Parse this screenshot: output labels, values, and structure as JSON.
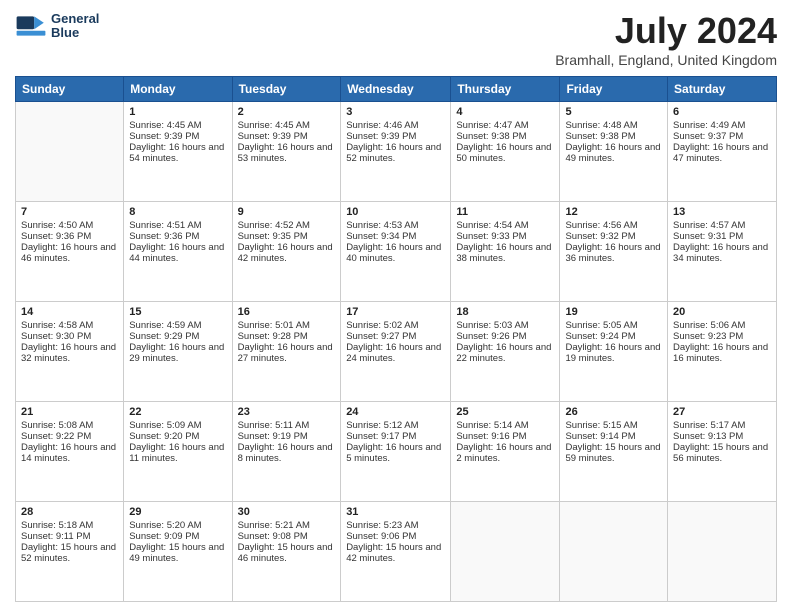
{
  "header": {
    "logo_line1": "General",
    "logo_line2": "Blue",
    "month": "July 2024",
    "location": "Bramhall, England, United Kingdom"
  },
  "days_of_week": [
    "Sunday",
    "Monday",
    "Tuesday",
    "Wednesday",
    "Thursday",
    "Friday",
    "Saturday"
  ],
  "weeks": [
    [
      {
        "day": "",
        "sunrise": "",
        "sunset": "",
        "daylight": ""
      },
      {
        "day": "1",
        "sunrise": "Sunrise: 4:45 AM",
        "sunset": "Sunset: 9:39 PM",
        "daylight": "Daylight: 16 hours and 54 minutes."
      },
      {
        "day": "2",
        "sunrise": "Sunrise: 4:45 AM",
        "sunset": "Sunset: 9:39 PM",
        "daylight": "Daylight: 16 hours and 53 minutes."
      },
      {
        "day": "3",
        "sunrise": "Sunrise: 4:46 AM",
        "sunset": "Sunset: 9:39 PM",
        "daylight": "Daylight: 16 hours and 52 minutes."
      },
      {
        "day": "4",
        "sunrise": "Sunrise: 4:47 AM",
        "sunset": "Sunset: 9:38 PM",
        "daylight": "Daylight: 16 hours and 50 minutes."
      },
      {
        "day": "5",
        "sunrise": "Sunrise: 4:48 AM",
        "sunset": "Sunset: 9:38 PM",
        "daylight": "Daylight: 16 hours and 49 minutes."
      },
      {
        "day": "6",
        "sunrise": "Sunrise: 4:49 AM",
        "sunset": "Sunset: 9:37 PM",
        "daylight": "Daylight: 16 hours and 47 minutes."
      }
    ],
    [
      {
        "day": "7",
        "sunrise": "Sunrise: 4:50 AM",
        "sunset": "Sunset: 9:36 PM",
        "daylight": "Daylight: 16 hours and 46 minutes."
      },
      {
        "day": "8",
        "sunrise": "Sunrise: 4:51 AM",
        "sunset": "Sunset: 9:36 PM",
        "daylight": "Daylight: 16 hours and 44 minutes."
      },
      {
        "day": "9",
        "sunrise": "Sunrise: 4:52 AM",
        "sunset": "Sunset: 9:35 PM",
        "daylight": "Daylight: 16 hours and 42 minutes."
      },
      {
        "day": "10",
        "sunrise": "Sunrise: 4:53 AM",
        "sunset": "Sunset: 9:34 PM",
        "daylight": "Daylight: 16 hours and 40 minutes."
      },
      {
        "day": "11",
        "sunrise": "Sunrise: 4:54 AM",
        "sunset": "Sunset: 9:33 PM",
        "daylight": "Daylight: 16 hours and 38 minutes."
      },
      {
        "day": "12",
        "sunrise": "Sunrise: 4:56 AM",
        "sunset": "Sunset: 9:32 PM",
        "daylight": "Daylight: 16 hours and 36 minutes."
      },
      {
        "day": "13",
        "sunrise": "Sunrise: 4:57 AM",
        "sunset": "Sunset: 9:31 PM",
        "daylight": "Daylight: 16 hours and 34 minutes."
      }
    ],
    [
      {
        "day": "14",
        "sunrise": "Sunrise: 4:58 AM",
        "sunset": "Sunset: 9:30 PM",
        "daylight": "Daylight: 16 hours and 32 minutes."
      },
      {
        "day": "15",
        "sunrise": "Sunrise: 4:59 AM",
        "sunset": "Sunset: 9:29 PM",
        "daylight": "Daylight: 16 hours and 29 minutes."
      },
      {
        "day": "16",
        "sunrise": "Sunrise: 5:01 AM",
        "sunset": "Sunset: 9:28 PM",
        "daylight": "Daylight: 16 hours and 27 minutes."
      },
      {
        "day": "17",
        "sunrise": "Sunrise: 5:02 AM",
        "sunset": "Sunset: 9:27 PM",
        "daylight": "Daylight: 16 hours and 24 minutes."
      },
      {
        "day": "18",
        "sunrise": "Sunrise: 5:03 AM",
        "sunset": "Sunset: 9:26 PM",
        "daylight": "Daylight: 16 hours and 22 minutes."
      },
      {
        "day": "19",
        "sunrise": "Sunrise: 5:05 AM",
        "sunset": "Sunset: 9:24 PM",
        "daylight": "Daylight: 16 hours and 19 minutes."
      },
      {
        "day": "20",
        "sunrise": "Sunrise: 5:06 AM",
        "sunset": "Sunset: 9:23 PM",
        "daylight": "Daylight: 16 hours and 16 minutes."
      }
    ],
    [
      {
        "day": "21",
        "sunrise": "Sunrise: 5:08 AM",
        "sunset": "Sunset: 9:22 PM",
        "daylight": "Daylight: 16 hours and 14 minutes."
      },
      {
        "day": "22",
        "sunrise": "Sunrise: 5:09 AM",
        "sunset": "Sunset: 9:20 PM",
        "daylight": "Daylight: 16 hours and 11 minutes."
      },
      {
        "day": "23",
        "sunrise": "Sunrise: 5:11 AM",
        "sunset": "Sunset: 9:19 PM",
        "daylight": "Daylight: 16 hours and 8 minutes."
      },
      {
        "day": "24",
        "sunrise": "Sunrise: 5:12 AM",
        "sunset": "Sunset: 9:17 PM",
        "daylight": "Daylight: 16 hours and 5 minutes."
      },
      {
        "day": "25",
        "sunrise": "Sunrise: 5:14 AM",
        "sunset": "Sunset: 9:16 PM",
        "daylight": "Daylight: 16 hours and 2 minutes."
      },
      {
        "day": "26",
        "sunrise": "Sunrise: 5:15 AM",
        "sunset": "Sunset: 9:14 PM",
        "daylight": "Daylight: 15 hours and 59 minutes."
      },
      {
        "day": "27",
        "sunrise": "Sunrise: 5:17 AM",
        "sunset": "Sunset: 9:13 PM",
        "daylight": "Daylight: 15 hours and 56 minutes."
      }
    ],
    [
      {
        "day": "28",
        "sunrise": "Sunrise: 5:18 AM",
        "sunset": "Sunset: 9:11 PM",
        "daylight": "Daylight: 15 hours and 52 minutes."
      },
      {
        "day": "29",
        "sunrise": "Sunrise: 5:20 AM",
        "sunset": "Sunset: 9:09 PM",
        "daylight": "Daylight: 15 hours and 49 minutes."
      },
      {
        "day": "30",
        "sunrise": "Sunrise: 5:21 AM",
        "sunset": "Sunset: 9:08 PM",
        "daylight": "Daylight: 15 hours and 46 minutes."
      },
      {
        "day": "31",
        "sunrise": "Sunrise: 5:23 AM",
        "sunset": "Sunset: 9:06 PM",
        "daylight": "Daylight: 15 hours and 42 minutes."
      },
      {
        "day": "",
        "sunrise": "",
        "sunset": "",
        "daylight": ""
      },
      {
        "day": "",
        "sunrise": "",
        "sunset": "",
        "daylight": ""
      },
      {
        "day": "",
        "sunrise": "",
        "sunset": "",
        "daylight": ""
      }
    ]
  ]
}
